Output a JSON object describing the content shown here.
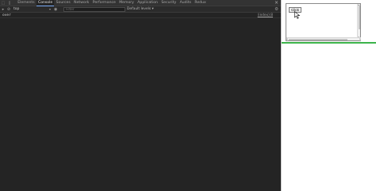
{
  "devtools": {
    "tabs": [
      {
        "label": "Elements",
        "active": false
      },
      {
        "label": "Console",
        "active": true
      },
      {
        "label": "Sources",
        "active": false
      },
      {
        "label": "Network",
        "active": false
      },
      {
        "label": "Performance",
        "active": false
      },
      {
        "label": "Memory",
        "active": false
      },
      {
        "label": "Application",
        "active": false
      },
      {
        "label": "Security",
        "active": false
      },
      {
        "label": "Audits",
        "active": false
      },
      {
        "label": "Redux",
        "active": false
      }
    ],
    "toolbar": {
      "context": "top",
      "filter_placeholder": "Filter",
      "levels_label": "Default levels ▾"
    },
    "console": {
      "messages": [
        {
          "text": "over",
          "source": "(index):8"
        }
      ]
    }
  },
  "page": {
    "button_label": "Click"
  },
  "colors": {
    "devtools_bg": "#242424",
    "active_tab_underline": "#7cacf8",
    "page_bg": "#ffffff",
    "green_line": "#3cb34a"
  },
  "icons": [
    "select-element-icon",
    "device-toolbar-icon",
    "close-icon",
    "clear-console-icon",
    "block-icon",
    "eye-icon",
    "settings-gear-icon",
    "cursor-icon"
  ]
}
